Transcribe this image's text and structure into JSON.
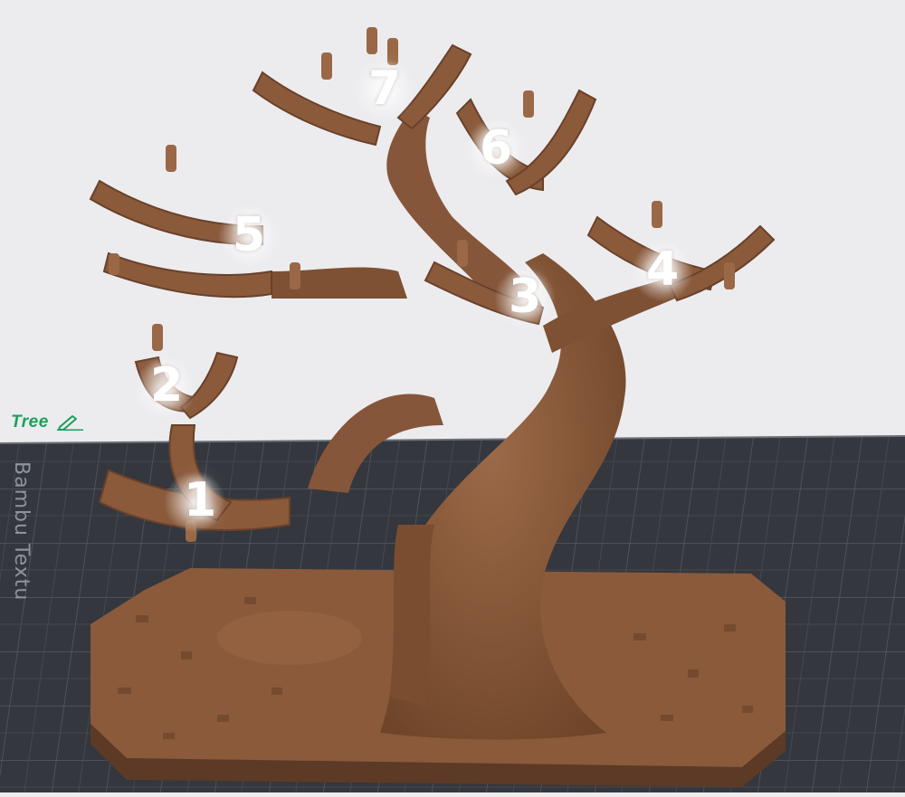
{
  "viewport": {
    "background": "#ececef",
    "plate_color": "#34373d",
    "grid_color": "#555a62",
    "model_color": "#8a5a3b"
  },
  "plate": {
    "label": "Bambu Textu"
  },
  "object": {
    "name": "Tree",
    "edit_icon": "pencil-icon",
    "name_color": "#19a05a"
  },
  "branch_labels": [
    "1",
    "2",
    "3",
    "4",
    "5",
    "6",
    "7"
  ]
}
